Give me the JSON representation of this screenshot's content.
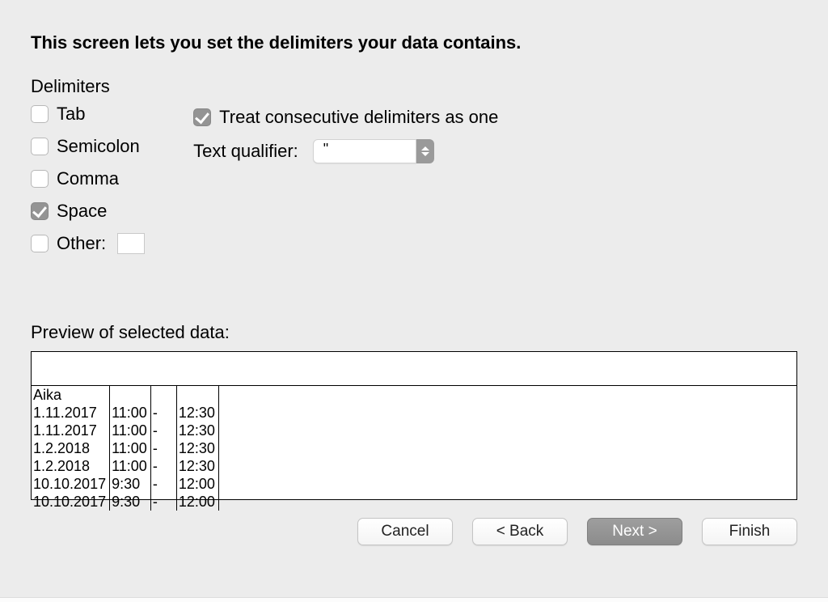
{
  "heading": "This screen lets you set the delimiters your data contains.",
  "delimiters": {
    "section_label": "Delimiters",
    "tab": {
      "label": "Tab",
      "checked": false
    },
    "semicolon": {
      "label": "Semicolon",
      "checked": false
    },
    "comma": {
      "label": "Comma",
      "checked": false
    },
    "space": {
      "label": "Space",
      "checked": true
    },
    "other": {
      "label": "Other:",
      "checked": false,
      "value": ""
    }
  },
  "options": {
    "consecutive": {
      "label": "Treat consecutive delimiters as one",
      "checked": true
    },
    "qualifier_label": "Text qualifier:",
    "qualifier_value": "\""
  },
  "preview": {
    "label": "Preview of selected data:",
    "header_row": [
      "Aika",
      "",
      "",
      ""
    ],
    "rows": [
      [
        "1.11.2017",
        "11:00",
        "-",
        "12:30"
      ],
      [
        "1.11.2017",
        "11:00",
        "-",
        "12:30"
      ],
      [
        "1.2.2018",
        "11:00",
        "-",
        "12:30"
      ],
      [
        "1.2.2018",
        "11:00",
        "-",
        "12:30"
      ],
      [
        "10.10.2017",
        "9:30",
        "-",
        "12:00"
      ],
      [
        "10.10.2017",
        "9:30",
        "-",
        "12:00"
      ]
    ]
  },
  "buttons": {
    "cancel": "Cancel",
    "back": "< Back",
    "next": "Next >",
    "finish": "Finish"
  }
}
